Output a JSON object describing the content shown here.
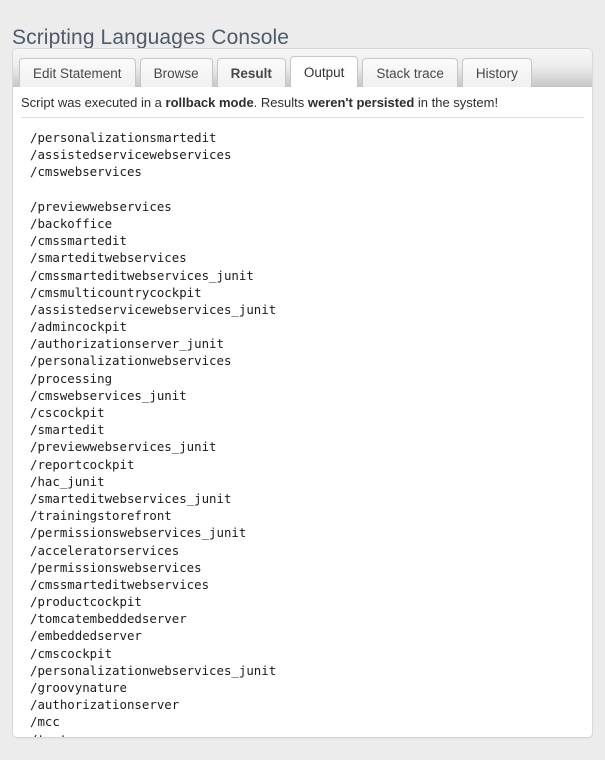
{
  "page": {
    "title": "Scripting Languages Console"
  },
  "tabs": [
    {
      "label": "Edit Statement",
      "active": false,
      "bold": false
    },
    {
      "label": "Browse",
      "active": false,
      "bold": false
    },
    {
      "label": "Result",
      "active": false,
      "bold": true
    },
    {
      "label": "Output",
      "active": true,
      "bold": false
    },
    {
      "label": "Stack trace",
      "active": false,
      "bold": false
    },
    {
      "label": "History",
      "active": false,
      "bold": false
    }
  ],
  "notice": {
    "part1": "Script was executed in a ",
    "emphasis1": "rollback mode",
    "part2": ". Results ",
    "emphasis2": "weren't persisted",
    "part3": " in the system!"
  },
  "output": {
    "lines": [
      "/personalizationsmartedit",
      "/assistedservicewebservices",
      "/cmswebservices",
      "",
      "/previewwebservices",
      "/backoffice",
      "/cmssmartedit",
      "/smarteditwebservices",
      "/cmssmarteditwebservices_junit",
      "/cmsmulticountrycockpit",
      "/assistedservicewebservices_junit",
      "/admincockpit",
      "/authorizationserver_junit",
      "/personalizationwebservices",
      "/processing",
      "/cmswebservices_junit",
      "/cscockpit",
      "/smartedit",
      "/previewwebservices_junit",
      "/reportcockpit",
      "/hac_junit",
      "/smarteditwebservices_junit",
      "/trainingstorefront",
      "/permissionswebservices_junit",
      "/acceleratorservices",
      "/permissionswebservices",
      "/cmssmarteditwebservices",
      "/productcockpit",
      "/tomcatembeddedserver",
      "/embeddedserver",
      "/cmscockpit",
      "/personalizationwebservices_junit",
      "/groovynature",
      "/authorizationserver",
      "/mcc",
      "/test"
    ]
  },
  "colors": {
    "page_background": "#ececec",
    "panel_background": "#ffffff",
    "title_color": "#4d5b6b",
    "tab_border": "#c6c6c6",
    "text_color": "#1b1b1b"
  }
}
